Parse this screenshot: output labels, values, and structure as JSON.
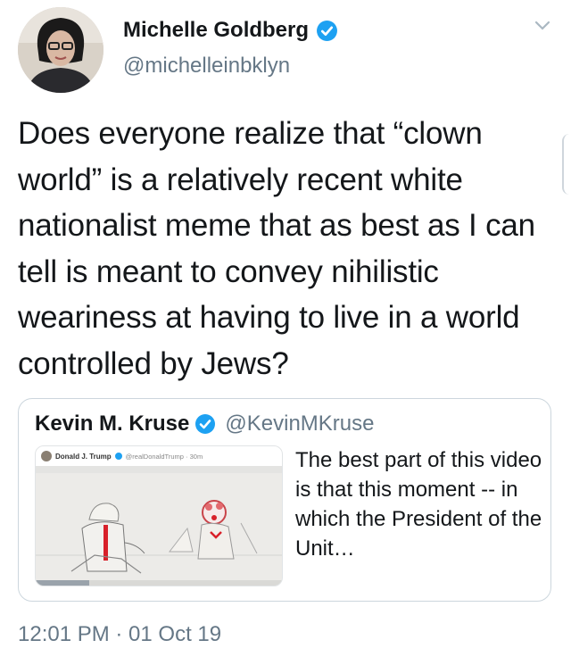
{
  "tweet": {
    "author_name": "Michelle Goldberg",
    "author_handle": "@michelleinbklyn",
    "text": "Does everyone realize that “clown world” is a relatively recent white nationalist meme that as best as I can tell is meant to convey nihilistic weariness at having to live in a world controlled by Jews?",
    "timestamp": "12:01 PM · 01 Oct 19",
    "icons": {
      "verified": "verified-badge-icon",
      "menu": "chevron-down-icon"
    }
  },
  "quoted": {
    "author_name": "Kevin M. Kruse",
    "author_handle": "@KevinMKruse",
    "text": "The best part of this video is that this moment -- in which the President of the Unit…",
    "media": {
      "embedded_name": "Donald J. Trump",
      "embedded_handle": "@realDonaldTrump · 30m"
    }
  },
  "colors": {
    "accent": "#1da1f2",
    "text": "#14171a",
    "muted": "#657786",
    "border": "#ccd6dd"
  }
}
